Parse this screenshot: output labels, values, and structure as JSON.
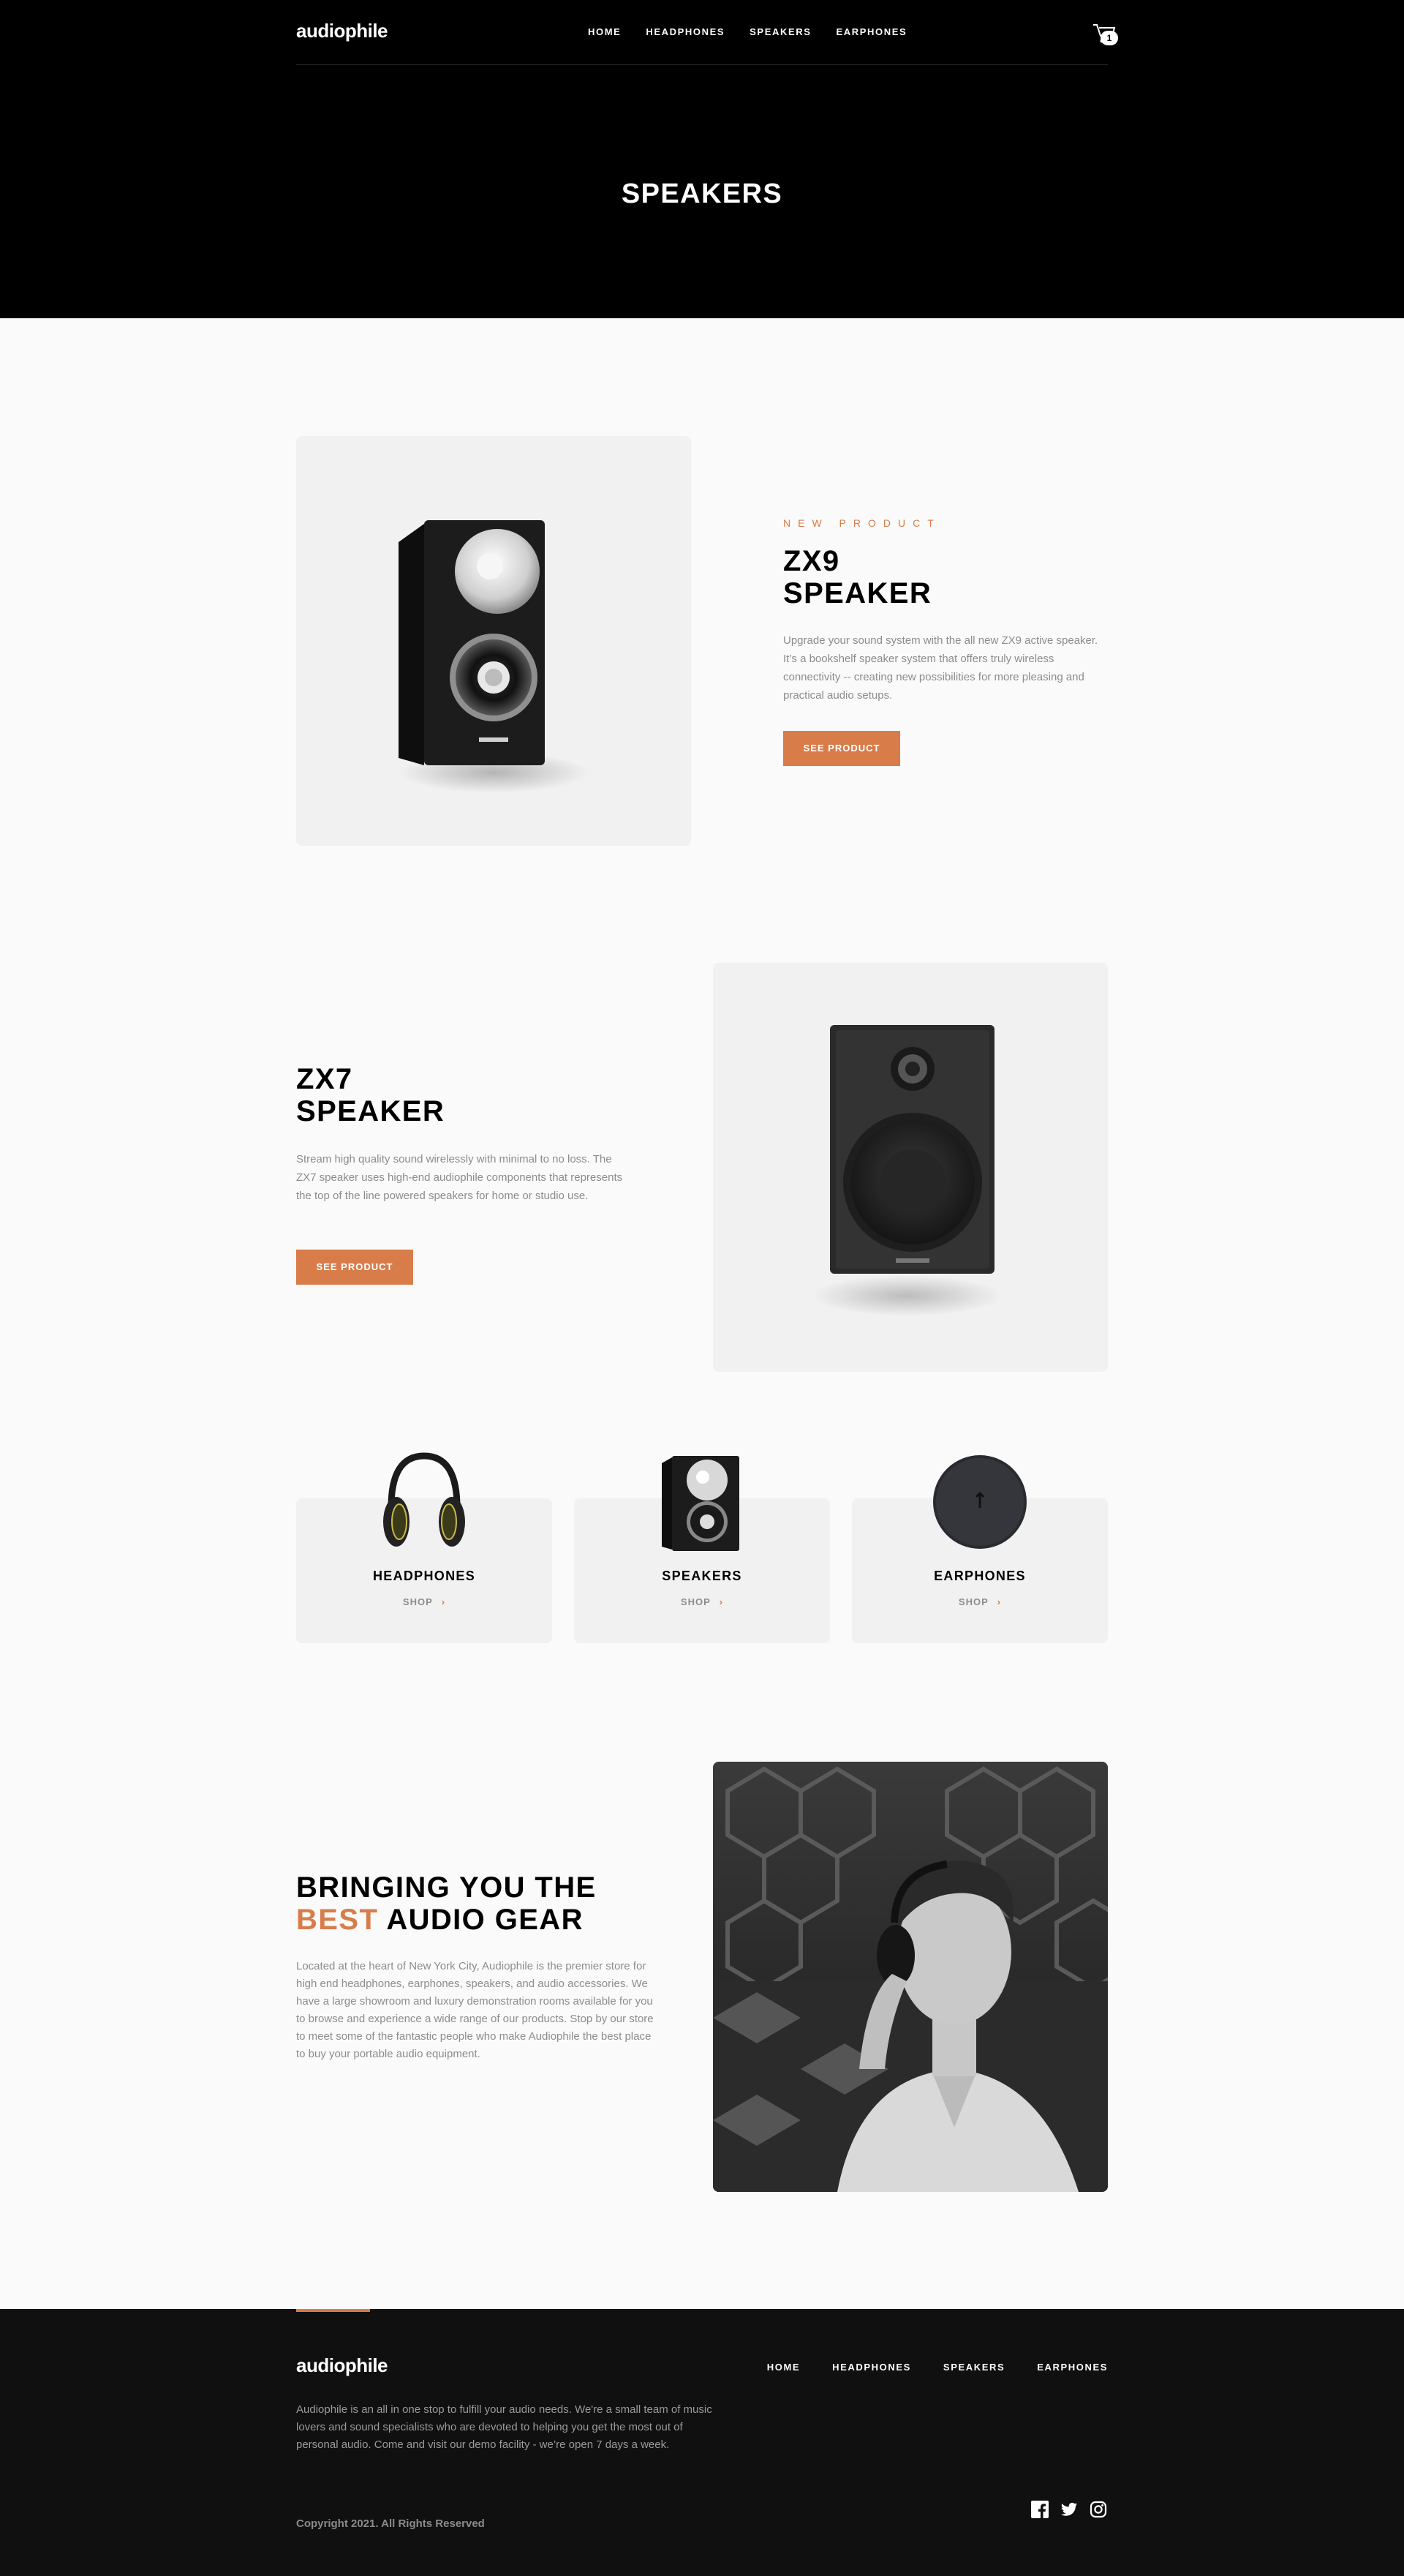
{
  "header": {
    "logo": "audiophile",
    "nav": [
      "HOME",
      "HEADPHONES",
      "SPEAKERS",
      "EARPHONES"
    ],
    "cart_count": "1",
    "page_title": "SPEAKERS"
  },
  "products": [
    {
      "overline": "NEW PRODUCT",
      "name_line1": "ZX9",
      "name_line2": "SPEAKER",
      "description": "Upgrade your sound system with the all new ZX9 active speaker. It’s a bookshelf speaker system that offers truly wireless connectivity -- creating new possibilities for more pleasing and practical audio setups.",
      "button": "SEE PRODUCT"
    },
    {
      "name_line1": "ZX7",
      "name_line2": "SPEAKER",
      "description": "Stream high quality sound wirelessly with minimal to no loss. The ZX7 speaker uses high-end audiophile components that represents the top of the line powered speakers for home or studio use.",
      "button": "SEE PRODUCT"
    }
  ],
  "categories": [
    {
      "name": "HEADPHONES",
      "shop": "SHOP"
    },
    {
      "name": "SPEAKERS",
      "shop": "SHOP"
    },
    {
      "name": "EARPHONES",
      "shop": "SHOP"
    }
  ],
  "about": {
    "title_line1": "BRINGING YOU THE",
    "title_accent": "BEST",
    "title_rest": "AUDIO GEAR",
    "text": "Located at the heart of New York City, Audiophile is the premier store for high end headphones, earphones, speakers, and audio accessories. We have a large showroom and luxury demonstration rooms available for you to browse and experience a wide range of our products. Stop by our store to meet some of the fantastic people who make Audiophile the best place to buy your portable audio equipment."
  },
  "footer": {
    "logo": "audiophile",
    "nav": [
      "HOME",
      "HEADPHONES",
      "SPEAKERS",
      "EARPHONES"
    ],
    "text": "Audiophile is an all in one stop to fulfill your audio needs. We're a small team of music lovers and sound specialists who are devoted to helping you get the most out of personal audio. Come and visit our demo facility - we’re open 7 days a week.",
    "copyright": "Copyright 2021. All Rights Reserved",
    "social": [
      "facebook-icon",
      "twitter-icon",
      "instagram-icon"
    ]
  },
  "colors": {
    "accent": "#D87D4A",
    "dark": "#101010",
    "light_gray": "#F1F1F1"
  }
}
